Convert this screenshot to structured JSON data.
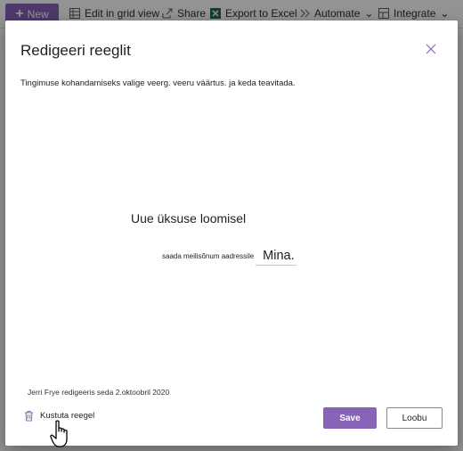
{
  "commandbar": {
    "new_label": "New",
    "edit_grid_label": "Edit in grid view",
    "share_label": "Share",
    "export_label": "Export to Excel",
    "automate_label": "Automate",
    "integrate_label": "Integrate"
  },
  "dialog": {
    "title": "Redigeeri reeglit",
    "close_icon": "close-icon",
    "instruction": "Tingimuse kohandamiseks valige veerg. veeru väärtus. ja keda teavitada.",
    "condition_title": "Uue üksuse loomisel",
    "send_label": "saada meilisõnum aadressile",
    "recipient": "Mina.",
    "edited_note": "Jerri Frye redigeeris seda 2.oktoobril 2020",
    "delete_label": "Kustuta reegel",
    "save_label": "Save",
    "cancel_label": "Loobu"
  },
  "colors": {
    "accent": "#8764b8",
    "overlay": "rgba(0,0,0,0.42)"
  }
}
